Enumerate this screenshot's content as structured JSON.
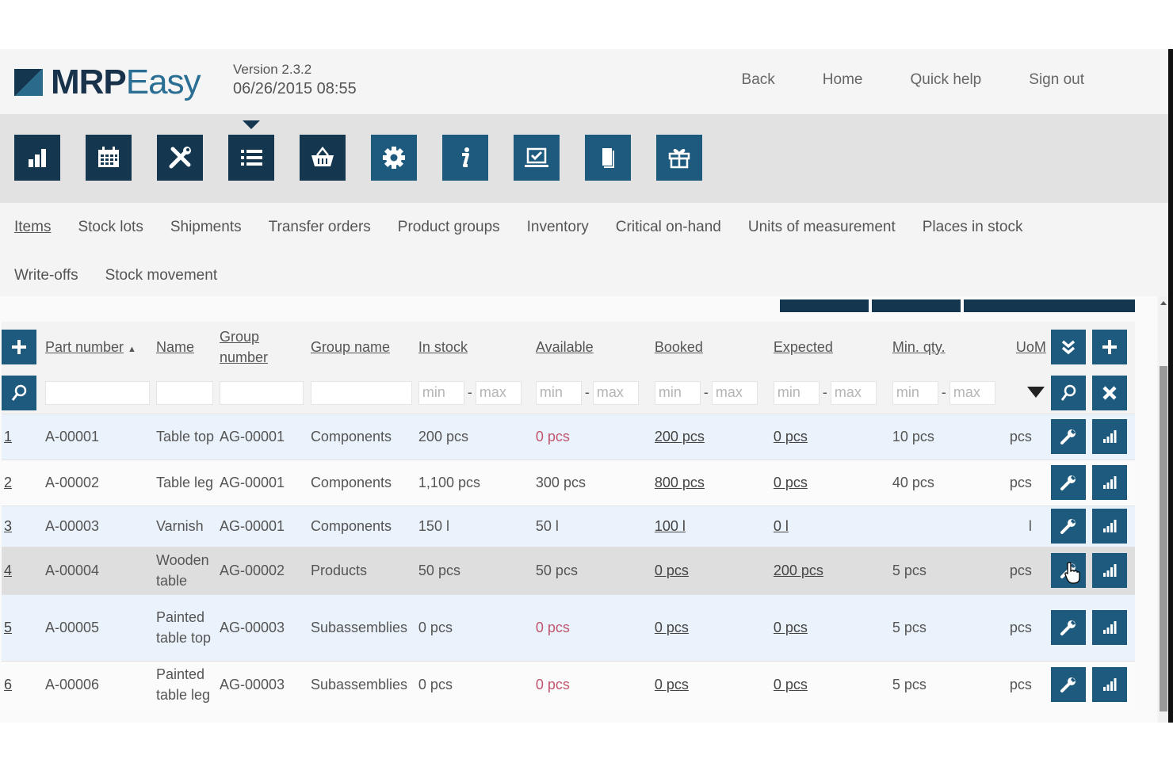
{
  "header": {
    "logo_part1": "MRP",
    "logo_part2": "Easy",
    "version": "Version 2.3.2",
    "datetime": "06/26/2015 08:55",
    "nav": [
      "Back",
      "Home",
      "Quick help",
      "Sign out"
    ]
  },
  "iconbar": {
    "active_index": 3,
    "items": [
      {
        "icon": "bar-chart-icon"
      },
      {
        "icon": "calendar-icon"
      },
      {
        "icon": "tools-icon"
      },
      {
        "icon": "list-icon"
      },
      {
        "icon": "basket-icon"
      },
      {
        "icon": "gear-icon"
      },
      {
        "icon": "info-icon"
      },
      {
        "icon": "laptop-check-icon"
      },
      {
        "icon": "documents-icon"
      },
      {
        "icon": "gift-icon"
      }
    ]
  },
  "subnav": {
    "row1": [
      "Items",
      "Stock lots",
      "Shipments",
      "Transfer orders",
      "Product groups",
      "Inventory",
      "Critical on-hand",
      "Units of measurement",
      "Places in stock"
    ],
    "row2": [
      "Write-offs",
      "Stock movement"
    ],
    "active": "Items"
  },
  "table": {
    "columns": {
      "part_number": "Part number",
      "name": "Name",
      "group_number": "Group number",
      "group_name": "Group name",
      "in_stock": "In stock",
      "available": "Available",
      "booked": "Booked",
      "expected": "Expected",
      "min_qty": "Min. qty.",
      "uom": "UoM"
    },
    "sort_indicator": "▲",
    "filter": {
      "min_placeholder": "min",
      "max_placeholder": "max",
      "separator": "-"
    },
    "rows": [
      {
        "num": "1",
        "part": "A-00001",
        "name": "Table top",
        "group_no": "AG-00001",
        "group_name": "Components",
        "in_stock": "200 pcs",
        "available": "0 pcs",
        "available_red": true,
        "booked": "200 pcs",
        "expected": "0 pcs",
        "min_qty": "10 pcs",
        "uom": "pcs"
      },
      {
        "num": "2",
        "part": "A-00002",
        "name": "Table leg",
        "group_no": "AG-00001",
        "group_name": "Components",
        "in_stock": "1,100 pcs",
        "available": "300 pcs",
        "available_red": false,
        "booked": "800 pcs",
        "expected": "0 pcs",
        "min_qty": "40 pcs",
        "uom": "pcs"
      },
      {
        "num": "3",
        "part": "A-00003",
        "name": "Varnish",
        "group_no": "AG-00001",
        "group_name": "Components",
        "in_stock": "150 l",
        "available": "50 l",
        "available_red": false,
        "booked": "100 l",
        "expected": "0 l",
        "min_qty": "",
        "uom": "l"
      },
      {
        "num": "4",
        "part": "A-00004",
        "name": "Wooden table",
        "group_no": "AG-00002",
        "group_name": "Products",
        "in_stock": "50 pcs",
        "available": "50 pcs",
        "available_red": false,
        "booked": "0 pcs",
        "expected": "200 pcs",
        "min_qty": "5 pcs",
        "uom": "pcs"
      },
      {
        "num": "5",
        "part": "A-00005",
        "name": "Painted table top",
        "group_no": "AG-00003",
        "group_name": "Subassemblies",
        "in_stock": "0 pcs",
        "available": "0 pcs",
        "available_red": true,
        "booked": "0 pcs",
        "expected": "0 pcs",
        "min_qty": "5 pcs",
        "uom": "pcs"
      },
      {
        "num": "6",
        "part": "A-00006",
        "name": "Painted table leg",
        "group_no": "AG-00003",
        "group_name": "Subassemblies",
        "in_stock": "0 pcs",
        "available": "0 pcs",
        "available_red": true,
        "booked": "0 pcs",
        "expected": "0 pcs",
        "min_qty": "5 pcs",
        "uom": "pcs"
      }
    ]
  },
  "colors": {
    "brand_dark": "#14374f",
    "brand": "#1e5a7e",
    "alert": "#c2566f"
  }
}
